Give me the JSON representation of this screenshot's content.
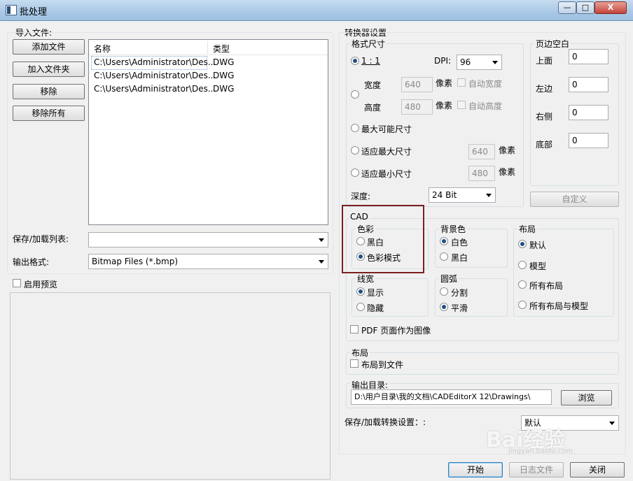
{
  "window": {
    "title": "批处理",
    "controls": {
      "minimize": "—",
      "maximize": "□",
      "close": "X"
    }
  },
  "import": {
    "label": "导入文件:",
    "buttons": {
      "add_file": "添加文件",
      "add_folder": "加入文件夹",
      "remove": "移除",
      "remove_all": "移除所有"
    },
    "columns": [
      "名称",
      "类型"
    ],
    "files": [
      {
        "name": "C:\\Users\\Administrator\\Des...",
        "type": "DWG"
      },
      {
        "name": "C:\\Users\\Administrator\\Des...",
        "type": "DWG"
      },
      {
        "name": "C:\\Users\\Administrator\\Des...",
        "type": "DWG"
      }
    ],
    "save_load_list_label": "保存/加载列表:",
    "save_load_list_value": "",
    "output_format_label": "输出格式:",
    "output_format_value": "Bitmap Files (*.bmp)",
    "enable_preview_label": "启用预览",
    "enable_preview_checked": false
  },
  "converter": {
    "label": "转换器设置",
    "format_size": {
      "label": "格式尺寸",
      "ratio_label": "1 : 1",
      "dpi_label": "DPI:",
      "dpi_value": "96",
      "width_label": "宽度",
      "width_value": "640",
      "height_label": "高度",
      "height_value": "480",
      "pixel_label": "像素",
      "auto_width_label": "自动宽度",
      "auto_height_label": "自动高度",
      "max_possible_label": "最大可能尺寸",
      "fit_max_label": "适应最大尺寸",
      "fit_max_value": "640",
      "fit_min_label": "适应最小尺寸",
      "fit_min_value": "480",
      "depth_label": "深度:",
      "depth_value": "24 Bit"
    },
    "margins": {
      "label": "页边空白",
      "top_label": "上面",
      "top_value": "0",
      "left_label": "左边",
      "left_value": "0",
      "right_label": "右侧",
      "right_value": "0",
      "bottom_label": "底部",
      "bottom_value": "0",
      "custom_button": "自定义"
    },
    "cad": {
      "label": "CAD",
      "color": {
        "label": "色彩",
        "bw": "黑白",
        "color_mode": "色彩模式"
      },
      "background": {
        "label": "背景色",
        "white": "白色",
        "black": "黑白"
      },
      "layout": {
        "label": "布局",
        "default": "默认",
        "model": "模型",
        "all_layouts": "所有布局",
        "all_layouts_model": "所有布局与模型"
      },
      "line_width": {
        "label": "线宽",
        "show": "显示",
        "hide": "隐藏"
      },
      "arc": {
        "label": "圆弧",
        "split": "分割",
        "smooth": "平滑"
      },
      "pdf_as_image_label": "PDF 页面作为图像"
    },
    "layout_section": {
      "label": "布局",
      "layout_to_file": "布局到文件"
    },
    "output_dir": {
      "label": "输出目录:",
      "value": "D:\\用户目录\\我的文档\\CADEditorX 12\\Drawings\\",
      "browse": "浏览"
    },
    "save_load_settings_label": "保存/加载转换设置：:",
    "save_load_settings_value": "默认"
  },
  "footer": {
    "start": "开始",
    "log": "日志文件",
    "close": "关闭"
  },
  "watermark": {
    "logo": "Bai经验",
    "url": "jingyan.baidu.com"
  }
}
